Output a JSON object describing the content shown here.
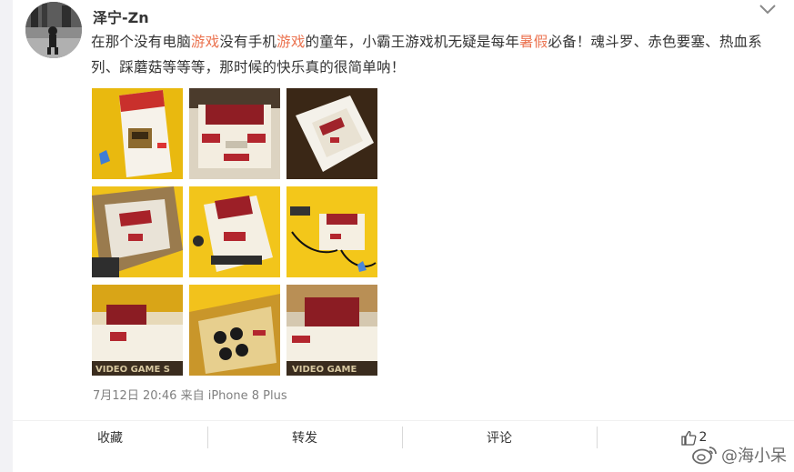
{
  "post": {
    "username": "泽宁-Zn",
    "text_parts": [
      {
        "t": "在那个没有电脑",
        "hl": false
      },
      {
        "t": "游戏",
        "hl": true
      },
      {
        "t": "没有手机",
        "hl": false
      },
      {
        "t": "游戏",
        "hl": true
      },
      {
        "t": "的童年，小霸王游戏机无疑是每年",
        "hl": false
      },
      {
        "t": "暑假",
        "hl": true
      },
      {
        "t": "必备！魂斗罗、赤色要塞、热血系列、踩蘑菇等等等，那时候的快乐真的很简单呐！",
        "hl": false
      }
    ],
    "timestamp": "7月12日 20:46",
    "source_prefix": "来自",
    "source_device": "iPhone 8 Plus",
    "photos": [
      "photo-1",
      "photo-2",
      "photo-3",
      "photo-4",
      "photo-5",
      "photo-6",
      "photo-7",
      "photo-8",
      "photo-9"
    ]
  },
  "actions": {
    "favorite_label": "收藏",
    "repost_label": "转发",
    "comment_label": "评论",
    "like_count": "2"
  },
  "watermark": {
    "text": "@海小呆"
  },
  "colors": {
    "highlight": "#eb7350",
    "console_red": "#b3262e",
    "console_cream": "#f3ede0",
    "background_yellow": "#f3c81b"
  }
}
